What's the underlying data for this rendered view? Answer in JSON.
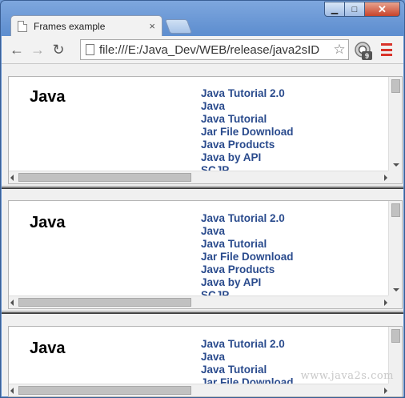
{
  "window": {
    "minimize_glyph": "▁",
    "maximize_glyph": "□",
    "close_glyph": "✕"
  },
  "tab": {
    "title": "Frames example",
    "close_glyph": "×"
  },
  "toolbar": {
    "back_glyph": "←",
    "forward_glyph": "→",
    "reload_glyph": "↻",
    "url": "file:///E:/Java_Dev/WEB/release/java2sID",
    "star_glyph": "☆",
    "extension_badge": "9"
  },
  "frames": [
    {
      "heading": "Java",
      "links": [
        "Java Tutorial 2.0",
        "Java",
        "Java Tutorial",
        "Jar File Download",
        "Java Products",
        "Java by API",
        "SCJP"
      ]
    },
    {
      "heading": "Java",
      "links": [
        "Java Tutorial 2.0",
        "Java",
        "Java Tutorial",
        "Jar File Download",
        "Java Products",
        "Java by API",
        "SCJP"
      ]
    },
    {
      "heading": "Java",
      "links": [
        "Java Tutorial 2.0",
        "Java",
        "Java Tutorial",
        "Jar File Download"
      ]
    }
  ],
  "watermark": "www.java2s.com",
  "colors": {
    "link": "#2a4b8d",
    "menu": "#d9342b"
  }
}
